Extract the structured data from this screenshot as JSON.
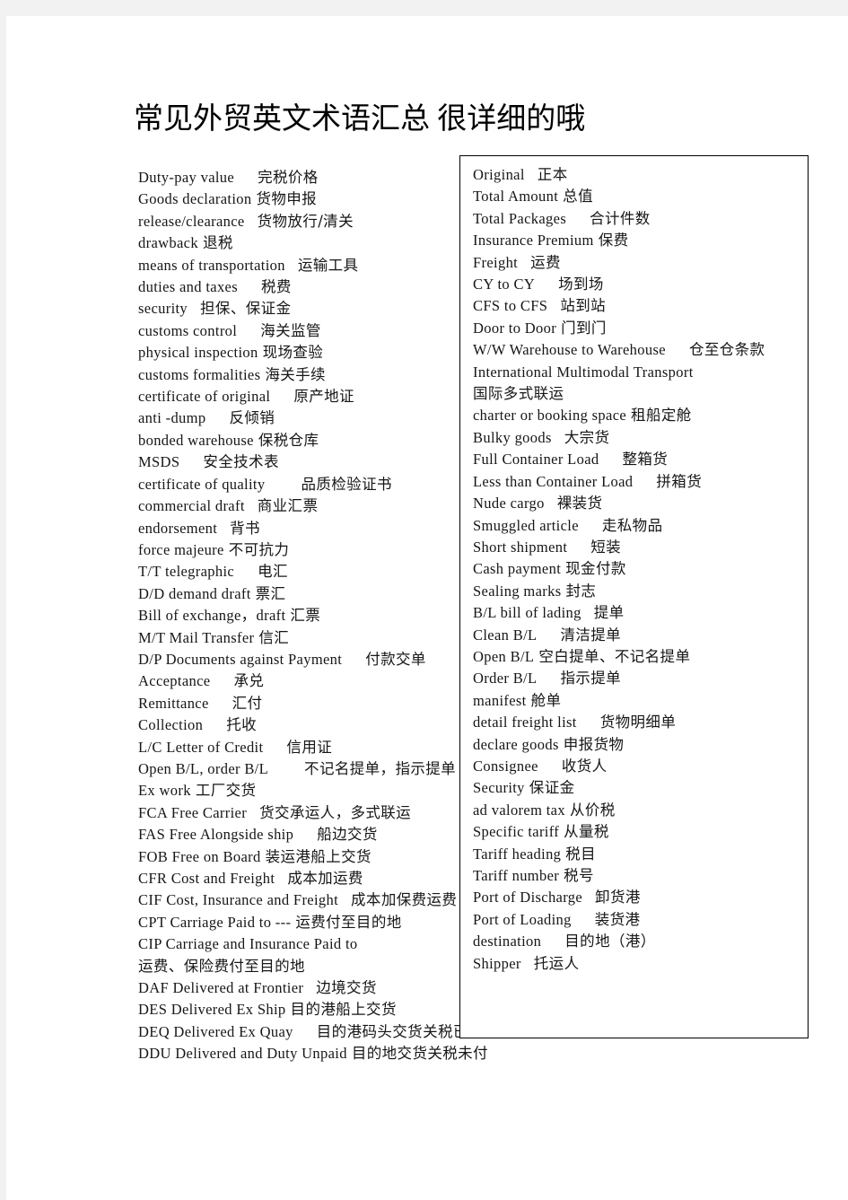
{
  "document": {
    "title": "常见外贸英文术语汇总  很详细的哦"
  },
  "left_column": [
    {
      "en": "Duty-pay  value",
      "zh": "完税价格",
      "gap": "l"
    },
    {
      "en": "Goods  declaration",
      "zh": "货物申报",
      "gap": "s"
    },
    {
      "en": "release/clearance",
      "zh": "货物放行/清关",
      "gap": "m"
    },
    {
      "en": "drawback",
      "zh": "退税",
      "gap": "s"
    },
    {
      "en": "means  of  transportation",
      "zh": "运输工具",
      "gap": "m"
    },
    {
      "en": "duties  and  taxes",
      "zh": "税费",
      "gap": "l"
    },
    {
      "en": "security",
      "zh": "担保、保证金",
      "gap": "m"
    },
    {
      "en": "customs  control",
      "zh": "海关监管",
      "gap": "l"
    },
    {
      "en": "physical  inspection",
      "zh": "现场查验",
      "gap": "s"
    },
    {
      "en": "customs  formalities",
      "zh": "海关手续",
      "gap": "s"
    },
    {
      "en": "certificate  of  original",
      "zh": "原产地证",
      "gap": "l"
    },
    {
      "en": "anti  -dump",
      "zh": "反倾销",
      "gap": "l"
    },
    {
      "en": "bonded  warehouse",
      "zh": "保税仓库",
      "gap": "s"
    },
    {
      "en": "MSDS",
      "zh": "安全技术表",
      "gap": "l"
    },
    {
      "en": "certificate  of  quality",
      "zh": "品质检验证书",
      "gap": "xl"
    },
    {
      "en": "commercial  draft",
      "zh": "商业汇票",
      "gap": "m"
    },
    {
      "en": "endorsement",
      "zh": "背书",
      "gap": "m"
    },
    {
      "en": "force  majeure",
      "zh": "不可抗力",
      "gap": "s"
    },
    {
      "en": "T/T  telegraphic",
      "zh": "电汇",
      "gap": "l"
    },
    {
      "en": "D/D  demand  draft",
      "zh": "票汇",
      "gap": "s"
    },
    {
      "en": "Bill  of  exchange，draft",
      "zh": "汇票",
      "gap": "s"
    },
    {
      "en": "M/T  Mail  Transfer",
      "zh": "信汇",
      "gap": "s"
    },
    {
      "en": "D/P  Documents  against  Payment",
      "zh": "付款交单",
      "gap": "l"
    },
    {
      "en": "Acceptance",
      "zh": "承兑",
      "gap": "l"
    },
    {
      "en": "Remittance",
      "zh": "汇付",
      "gap": "l"
    },
    {
      "en": "Collection",
      "zh": "托收",
      "gap": "l"
    },
    {
      "en": "L/C  Letter  of  Credit",
      "zh": "信用证",
      "gap": "l"
    },
    {
      "en": "Open  B/L, order  B/L",
      "zh": "不记名提单，指示提单",
      "gap": "xl"
    },
    {
      "en": "Ex  work",
      "zh": "工厂交货",
      "gap": "s"
    },
    {
      "en": "FCA  Free  Carrier",
      "zh": "货交承运人，多式联运",
      "gap": "m"
    },
    {
      "en": "FAS  Free  Alongside  ship",
      "zh": "船边交货",
      "gap": "l"
    },
    {
      "en": "FOB  Free  on  Board",
      "zh": "装运港船上交货",
      "gap": "s"
    },
    {
      "en": "CFR  Cost  and  Freight",
      "zh": "成本加运费",
      "gap": "m"
    },
    {
      "en": "CIF  Cost, Insurance  and  Freight",
      "zh": "成本加保费运费",
      "gap": "m"
    },
    {
      "en": "CPT  Carriage  Paid  to  ---",
      "zh": "运费付至目的地",
      "gap": "s"
    },
    {
      "en": "CIP  Carriage  and  Insurance  Paid  to",
      "zh": "运费、保险费付至目的地",
      "gap": "wrap"
    },
    {
      "en": "DAF  Delivered  at  Frontier",
      "zh": "边境交货",
      "gap": "m"
    },
    {
      "en": "DES  Delivered  Ex  Ship",
      "zh": "目的港船上交货",
      "gap": "s"
    },
    {
      "en": "DEQ  Delivered  Ex  Quay",
      "zh": "目的港码头交货关税已付",
      "gap": "l"
    },
    {
      "en": "DDU  Delivered  and  Duty  Unpaid",
      "zh": "目的地交货关税未付",
      "gap": "s"
    }
  ],
  "right_column": [
    {
      "en": "Original",
      "zh": "正本",
      "gap": "m"
    },
    {
      "en": "Total  Amount",
      "zh": "总值",
      "gap": "s"
    },
    {
      "en": "Total  Packages",
      "zh": "合计件数",
      "gap": "l"
    },
    {
      "en": "Insurance  Premium",
      "zh": "保费",
      "gap": "s"
    },
    {
      "en": "Freight",
      "zh": "运费",
      "gap": "m"
    },
    {
      "en": "CY  to  CY",
      "zh": "场到场",
      "gap": "l"
    },
    {
      "en": "CFS  to  CFS",
      "zh": "站到站",
      "gap": "m"
    },
    {
      "en": "Door  to  Door",
      "zh": "门到门",
      "gap": "s"
    },
    {
      "en": "W/W  Warehouse  to  Warehouse",
      "zh": "仓至仓条款",
      "gap": "l"
    },
    {
      "en": "International  Multimodal  Transport",
      "zh": "国际多式联运",
      "gap": "wrap"
    },
    {
      "en": "charter  or  booking  space",
      "zh": "租船定舱",
      "gap": "s"
    },
    {
      "en": "Bulky  goods",
      "zh": "大宗货",
      "gap": "m"
    },
    {
      "en": "Full  Container  Load",
      "zh": "整箱货",
      "gap": "l"
    },
    {
      "en": "Less  than  Container  Load",
      "zh": "拼箱货",
      "gap": "l"
    },
    {
      "en": "Nude  cargo",
      "zh": "裸装货",
      "gap": "m"
    },
    {
      "en": "Smuggled  article",
      "zh": "走私物品",
      "gap": "l"
    },
    {
      "en": "Short  shipment",
      "zh": "短装",
      "gap": "l"
    },
    {
      "en": "Cash  payment",
      "zh": "现金付款",
      "gap": "s"
    },
    {
      "en": "Sealing  marks",
      "zh": "封志",
      "gap": "s"
    },
    {
      "en": "B/L  bill  of  lading",
      "zh": "提单",
      "gap": "m"
    },
    {
      "en": "Clean  B/L",
      "zh": "清洁提单",
      "gap": "l"
    },
    {
      "en": "Open  B/L",
      "zh": "空白提单、不记名提单",
      "gap": "s"
    },
    {
      "en": "Order  B/L",
      "zh": "指示提单",
      "gap": "l"
    },
    {
      "en": "manifest",
      "zh": "舱单",
      "gap": "s"
    },
    {
      "en": "detail  freight  list",
      "zh": "货物明细单",
      "gap": "l"
    },
    {
      "en": "declare  goods",
      "zh": "申报货物",
      "gap": "s"
    },
    {
      "en": "Consignee",
      "zh": "收货人",
      "gap": "l"
    },
    {
      "en": "Security",
      "zh": "保证金",
      "gap": "s"
    },
    {
      "en": "ad  valorem  tax",
      "zh": "从价税",
      "gap": "s"
    },
    {
      "en": "Specific  tariff",
      "zh": "从量税",
      "gap": "s"
    },
    {
      "en": "Tariff  heading",
      "zh": "税目",
      "gap": "s"
    },
    {
      "en": "Tariff  number",
      "zh": "税号",
      "gap": "s"
    },
    {
      "en": "Port  of  Discharge",
      "zh": "卸货港",
      "gap": "m"
    },
    {
      "en": "Port  of  Loading",
      "zh": "装货港",
      "gap": "l"
    },
    {
      "en": "destination",
      "zh": "目的地（港）",
      "gap": "l"
    },
    {
      "en": "Shipper",
      "zh": "托运人",
      "gap": "m"
    }
  ]
}
